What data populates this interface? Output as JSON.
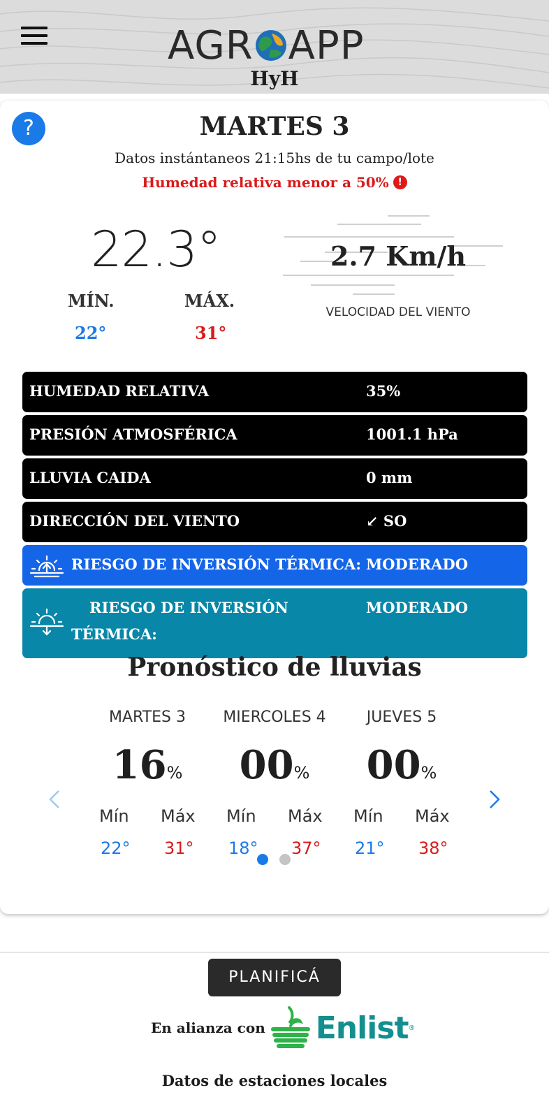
{
  "header": {
    "logo_left": "AGR",
    "logo_right": "APP",
    "subtitle": "HyH",
    "menu_icon": "hamburger-menu-icon",
    "logo_globe_colors": [
      "#1f6fb8",
      "#2f9a4b",
      "#e8a823"
    ]
  },
  "current": {
    "help_label": "?",
    "day_title": "MARTES 3",
    "instant_info": "Datos instántaneos 21:15hs de tu campo/lote",
    "alert_text": "Humedad relativa menor a 50%",
    "alert_icon": "!",
    "temperature": "22.3°",
    "min_label": "MÍN.",
    "max_label": "MÁX.",
    "min_value": "22°",
    "max_value": "31°",
    "wind_speed": "2.7 Km/h",
    "wind_label": "VELOCIDAD DEL VIENTO"
  },
  "rows": [
    {
      "label": "HUMEDAD RELATIVA",
      "value": "35%"
    },
    {
      "label": "PRESIÓN ATMOSFÉRICA",
      "value": "1001.1 hPa"
    },
    {
      "label": "LLUVIA CAIDA",
      "value": "0 mm"
    },
    {
      "label": "DIRECCIÓN DEL VIENTO",
      "value": "↙ SO"
    }
  ],
  "inversion": {
    "blue_label": "RIESGO DE INVERSIÓN TÉRMICA:",
    "blue_value": "MODERADO",
    "teal_label_line1": "RIESGO DE INVERSIÓN",
    "teal_label_line2": "TÉRMICA:",
    "teal_value": "MODERADO",
    "blue_icon": "sunrise-icon",
    "teal_icon": "sunset-icon"
  },
  "forecast": {
    "title": "Pronóstico de lluvias",
    "min_label": "Mín",
    "max_label": "Máx",
    "pct_symbol": "%",
    "days": [
      {
        "day": "MARTES 3",
        "pct": "16",
        "min": "22°",
        "max": "31°"
      },
      {
        "day": "MIERCOLES 4",
        "pct": "00",
        "min": "18°",
        "max": "37°"
      },
      {
        "day": "JUEVES 5",
        "pct": "00",
        "min": "21°",
        "max": "38°"
      }
    ],
    "pages": 2,
    "active_page": 1
  },
  "footer": {
    "plan_button": "PLANIFICÁ",
    "alliance_text": "En alianza con",
    "partner_name": "Enlist",
    "partner_reg": "®",
    "stations_text": "Datos de estaciones locales"
  },
  "colors": {
    "accent_blue": "#1a7ae8",
    "alert_red": "#d81b1b",
    "row_black": "#000000",
    "row_blue": "#1565e8",
    "row_teal": "#0887a8",
    "enlist_green": "#2fb24a",
    "enlist_teal": "#148f8f"
  }
}
